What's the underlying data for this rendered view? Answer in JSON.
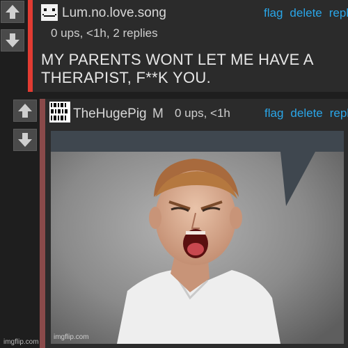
{
  "colors": {
    "accent_red": "#e23b32",
    "link": "#2aa6e8"
  },
  "comment1": {
    "username": "Lum.no.love.song",
    "meta": "0 ups, <1h, 2 replies",
    "body_line1": "MY PARENTS WONT LET ME HAVE A",
    "body_line2": "THERAPIST, F**K YOU.",
    "actions": {
      "flag": "flag",
      "delete": "delete",
      "reply": "reply"
    }
  },
  "comment2": {
    "username": "TheHugePig",
    "badge": "M",
    "meta": "0 ups, <1h",
    "actions": {
      "flag": "flag",
      "delete": "delete",
      "reply": "repl"
    },
    "image_watermark": "imgflip.com"
  },
  "footer": {
    "watermark": "imgflip.com"
  },
  "icons": [
    "up-arrow-icon",
    "down-arrow-icon",
    "avatar-icon"
  ]
}
